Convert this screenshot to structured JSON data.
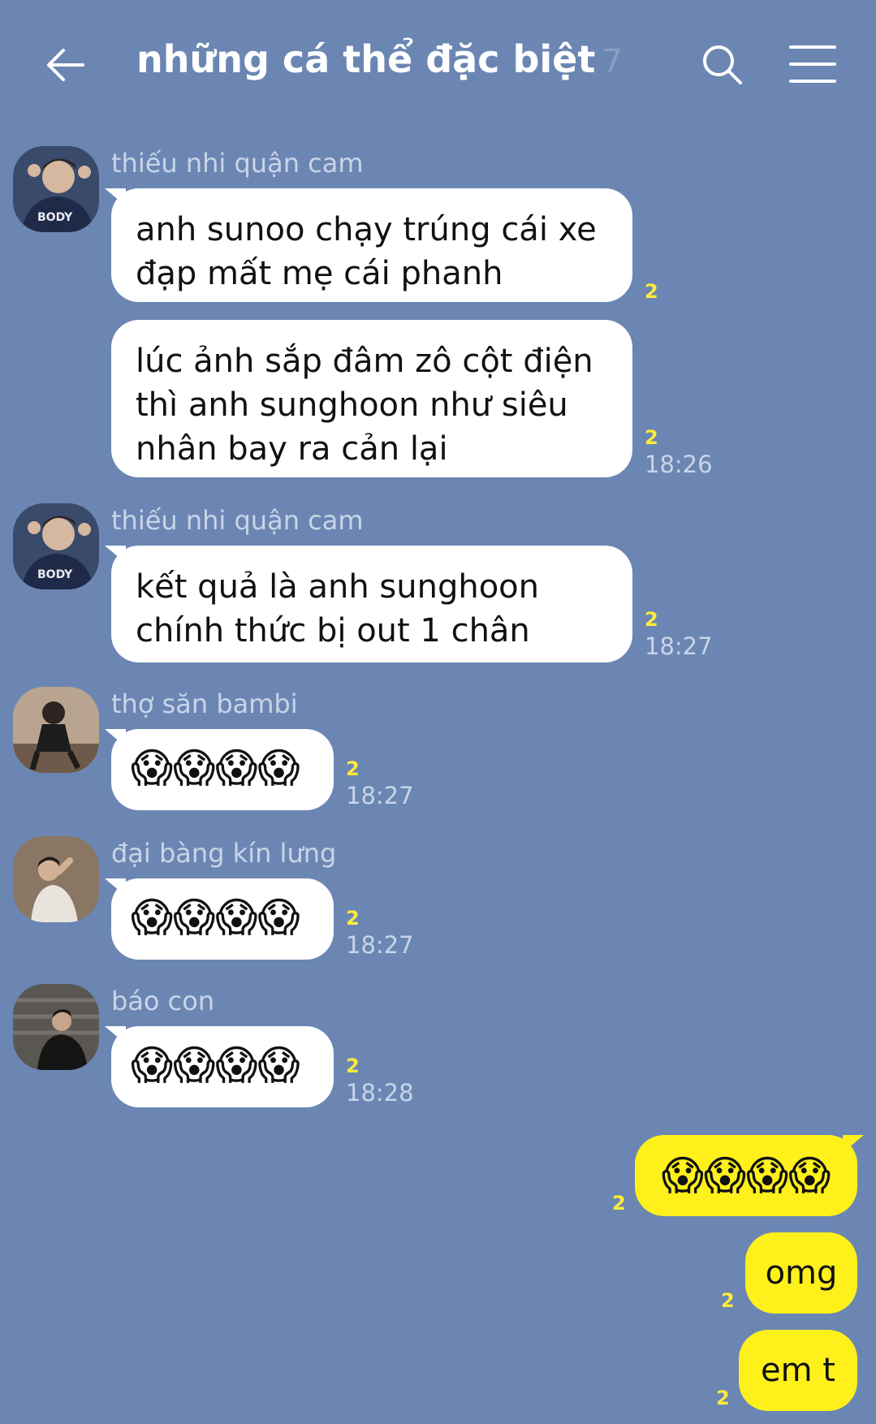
{
  "header": {
    "title": "những cá thể đặc biệt",
    "member_count": "7",
    "back_icon": "arrow-left-icon",
    "search_icon": "search-icon",
    "menu_icon": "hamburger-menu-icon"
  },
  "colors": {
    "background": "#6b86b3",
    "my_bubble": "#fef01b",
    "other_bubble": "#ffffff",
    "read_count": "#ffeb3b"
  },
  "messages": [
    {
      "sender": "thiếu nhi quận cam",
      "bubbles": [
        {
          "lines": [
            "anh sunoo chạy trúng cái xe",
            "đạp mất mẹ cái phanh"
          ],
          "read": "2",
          "time": ""
        },
        {
          "lines": [
            "lúc ảnh sắp đâm zô cột điện",
            "thì anh sunghoon như siêu",
            "nhân bay ra cản lại"
          ],
          "read": "2",
          "time": "18:26"
        }
      ]
    },
    {
      "sender": "thiếu nhi quận cam",
      "bubbles": [
        {
          "lines": [
            "kết quả là anh sunghoon",
            "chính thức bị out 1 chân"
          ],
          "read": "2",
          "time": "18:27"
        }
      ]
    },
    {
      "sender": "thợ săn bambi",
      "bubbles": [
        {
          "emoji": "😱😱😱😱",
          "read": "2",
          "time": "18:27"
        }
      ]
    },
    {
      "sender": "đại bàng kín lưng",
      "bubbles": [
        {
          "emoji": "😱😱😱😱",
          "read": "2",
          "time": "18:27"
        }
      ]
    },
    {
      "sender": "báo con",
      "bubbles": [
        {
          "emoji": "😱😱😱😱",
          "read": "2",
          "time": "18:28"
        }
      ]
    }
  ],
  "my_messages": [
    {
      "text": "😱😱😱😱",
      "read": "2"
    },
    {
      "text": "omg",
      "read": "2"
    },
    {
      "text": "em t",
      "read": "2"
    }
  ]
}
